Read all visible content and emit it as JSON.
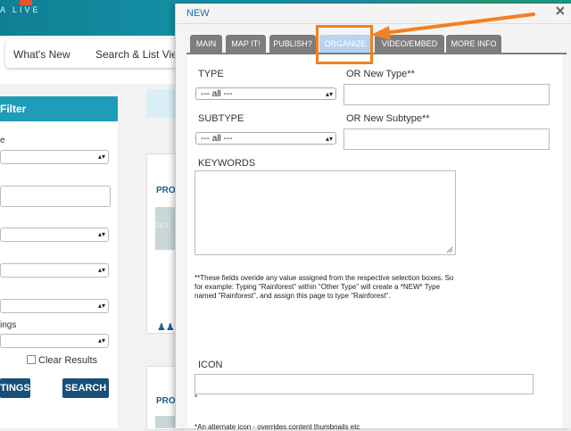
{
  "background": {
    "logo_text": "A LIVE",
    "nav": [
      "What's New",
      "Search & List View"
    ],
    "filter": {
      "heading": "Filter",
      "labels": [
        "e",
        "ings"
      ],
      "clear_results": "Clear Results",
      "buttons": [
        "TINGS",
        "SEARCH"
      ]
    },
    "card_title": "PRO",
    "card_img_text": "GE C"
  },
  "modal": {
    "title": "NEW",
    "tabs": [
      "MAIN",
      "MAP IT!",
      "PUBLISH?",
      "ORGANIZE",
      "VIDEO/EMBED",
      "MORE INFO"
    ],
    "active_tab": "ORGANIZE",
    "type_label": "TYPE",
    "type_value": "--- all ---",
    "new_type_label": "OR New Type**",
    "subtype_label": "SUBTYPE",
    "subtype_value": "--- all ---",
    "new_subtype_label": "OR New Subtype**",
    "keywords_label": "KEYWORDS",
    "note": "**These fields overide any value assigned from the respective selection boxes. So for example: Typing \"Rainforest\" within \"Other Type\" will create a *NEW* Type named \"Rainforest\", and assign this page to type \"Rainforest\".",
    "icon_label": "ICON",
    "icon_sub": "*",
    "alt_note": "*An alternate icon - overrides content thumbnails etc"
  },
  "annotation": {
    "color": "#f28022"
  }
}
